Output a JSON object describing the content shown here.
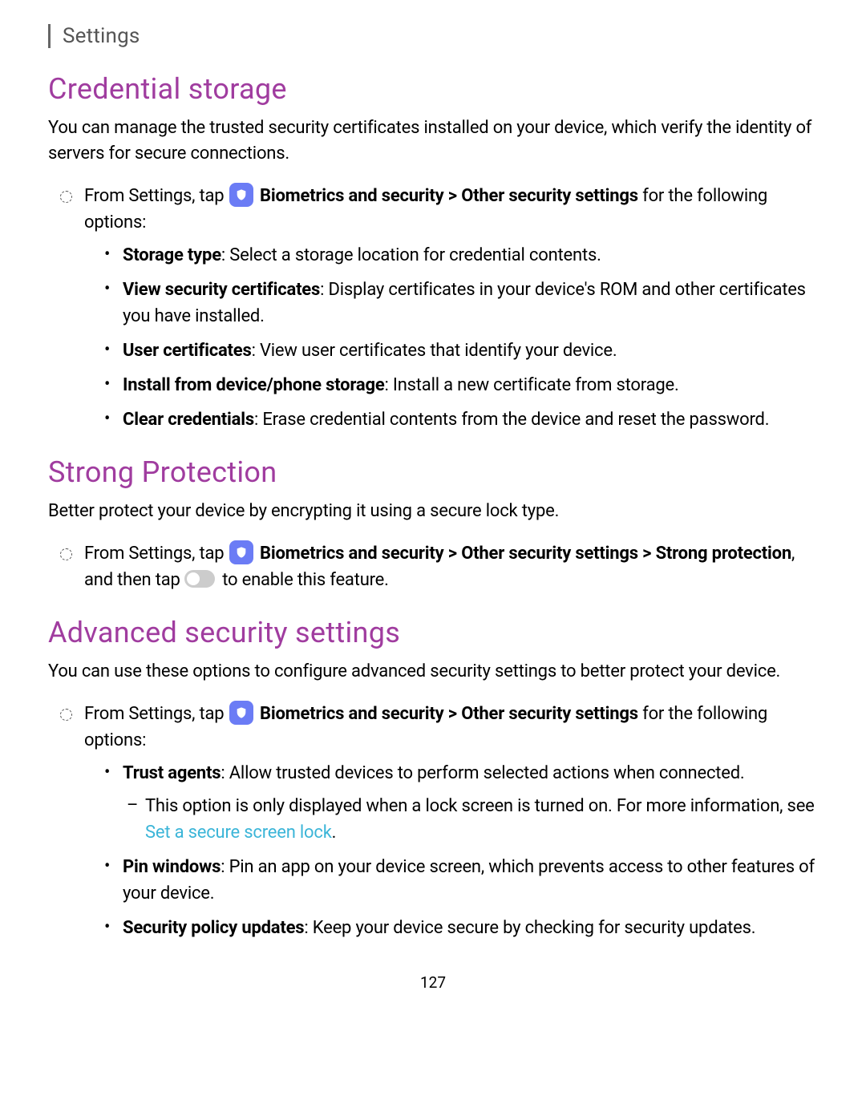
{
  "header": {
    "breadcrumb": "Settings"
  },
  "sections": {
    "credential": {
      "title": "Credential storage",
      "intro": "You can manage the trusted security certificates installed on your device, which verify the identity of servers for secure connections.",
      "lead_prefix": "From Settings, tap ",
      "nav1": "Biometrics and security",
      "gt1": " > ",
      "nav2": "Other security settings",
      "lead_suffix": " for the following options:",
      "items": [
        {
          "bold": "Storage type",
          "text": ": Select a storage location for credential contents."
        },
        {
          "bold": "View security certificates",
          "text": ": Display certificates in your device's ROM and other certificates you have installed."
        },
        {
          "bold": "User certificates",
          "text": ": View user certificates that identify your device."
        },
        {
          "bold": "Install from device/phone storage",
          "text": ": Install a new certificate from storage."
        },
        {
          "bold": "Clear credentials",
          "text": ": Erase credential contents from the device and reset the password."
        }
      ]
    },
    "strong": {
      "title": "Strong Protection",
      "intro": "Better protect your device by encrypting it using a secure lock type.",
      "lead_prefix": "From Settings, tap ",
      "nav1": "Biometrics and security",
      "gt1": " > ",
      "nav2": "Other security settings",
      "gt2": " > ",
      "nav3": "Strong protection",
      "mid": ", and then tap ",
      "suffix": " to enable this feature."
    },
    "advanced": {
      "title": "Advanced security settings",
      "intro": "You can use these options to configure advanced security settings to better protect your device.",
      "lead_prefix": "From Settings, tap ",
      "nav1": "Biometrics and security",
      "gt1": " > ",
      "nav2": "Other security settings",
      "lead_suffix": " for the following options:",
      "items": [
        {
          "bold": "Trust agents",
          "text": ": Allow trusted devices to perform selected actions when connected.",
          "sub_prefix": "This option is only displayed when a lock screen is turned on. For more information, see ",
          "sub_link": "Set a secure screen lock",
          "sub_suffix": "."
        },
        {
          "bold": "Pin windows",
          "text": ": Pin an app on your device screen, which prevents access to other features of your device."
        },
        {
          "bold": "Security policy updates",
          "text": ": Keep your device secure by checking for security updates."
        }
      ]
    }
  },
  "page_number": "127"
}
